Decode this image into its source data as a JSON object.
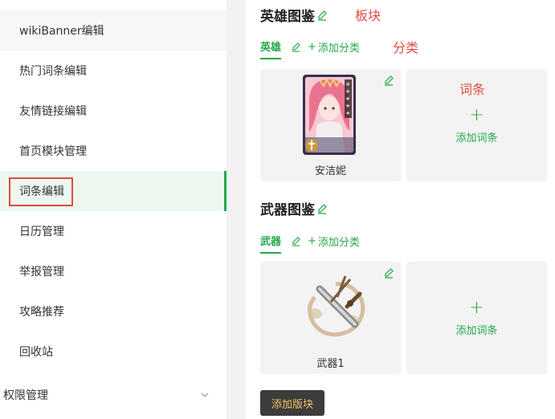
{
  "sidebar": {
    "items": [
      {
        "label": "wikiBanner编辑"
      },
      {
        "label": "热门词条编辑"
      },
      {
        "label": "友情链接编辑"
      },
      {
        "label": "首页模块管理"
      },
      {
        "label": "词条编辑"
      },
      {
        "label": "日历管理"
      },
      {
        "label": "举报管理"
      },
      {
        "label": "攻略推荐"
      },
      {
        "label": "回收站"
      }
    ],
    "group": {
      "label": "权限管理"
    }
  },
  "sections": [
    {
      "title": "英雄图鉴",
      "note": "板块",
      "tab": "英雄",
      "add_category": "添加分类",
      "category_note": "分类",
      "item": {
        "label": "安洁妮"
      },
      "add_item": "添加词条",
      "item_note": "词条"
    },
    {
      "title": "武器图鉴",
      "tab": "武器",
      "add_category": "添加分类",
      "item": {
        "label": "武器1"
      },
      "add_item": "添加词条"
    }
  ],
  "add_block_button": "添加版块",
  "colors": {
    "accent": "#22a84a",
    "annotation": "#e14a41",
    "button_bg": "#3c3c3c",
    "button_text": "#f3c567"
  }
}
